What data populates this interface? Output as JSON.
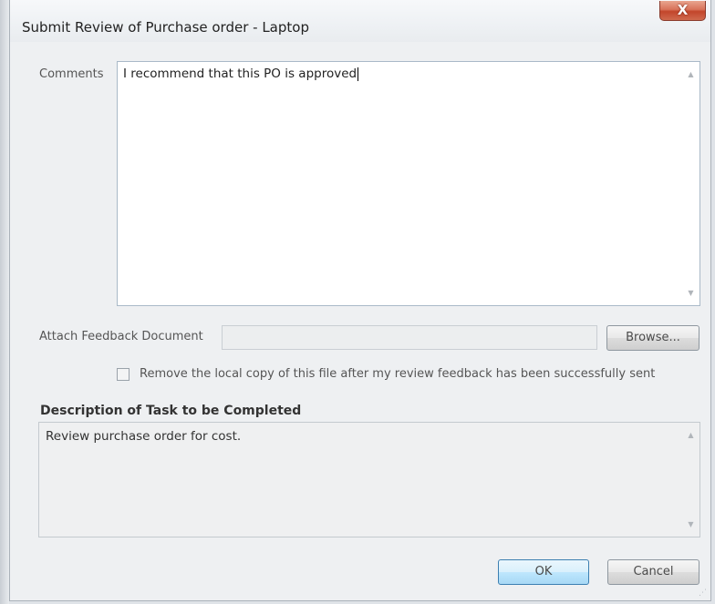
{
  "dialog": {
    "title": "Submit Review of Purchase order - Laptop",
    "close_label": "X"
  },
  "comments": {
    "label": "Comments",
    "value": "I recommend that this PO is approved"
  },
  "attach": {
    "label": "Attach Feedback Document",
    "value": "",
    "browse_label": "Browse..."
  },
  "remove_local_copy": {
    "label": "Remove the local copy of this file after my review feedback has been successfully sent",
    "checked": false
  },
  "task": {
    "heading": "Description of Task to be Completed",
    "description": "Review purchase order for cost."
  },
  "buttons": {
    "ok_label": "OK",
    "cancel_label": "Cancel"
  },
  "icons": {
    "scroll_up": "scroll-up-arrow-icon",
    "scroll_down": "scroll-down-arrow-icon",
    "close": "close-icon",
    "resize_grip": "resize-grip-icon"
  }
}
